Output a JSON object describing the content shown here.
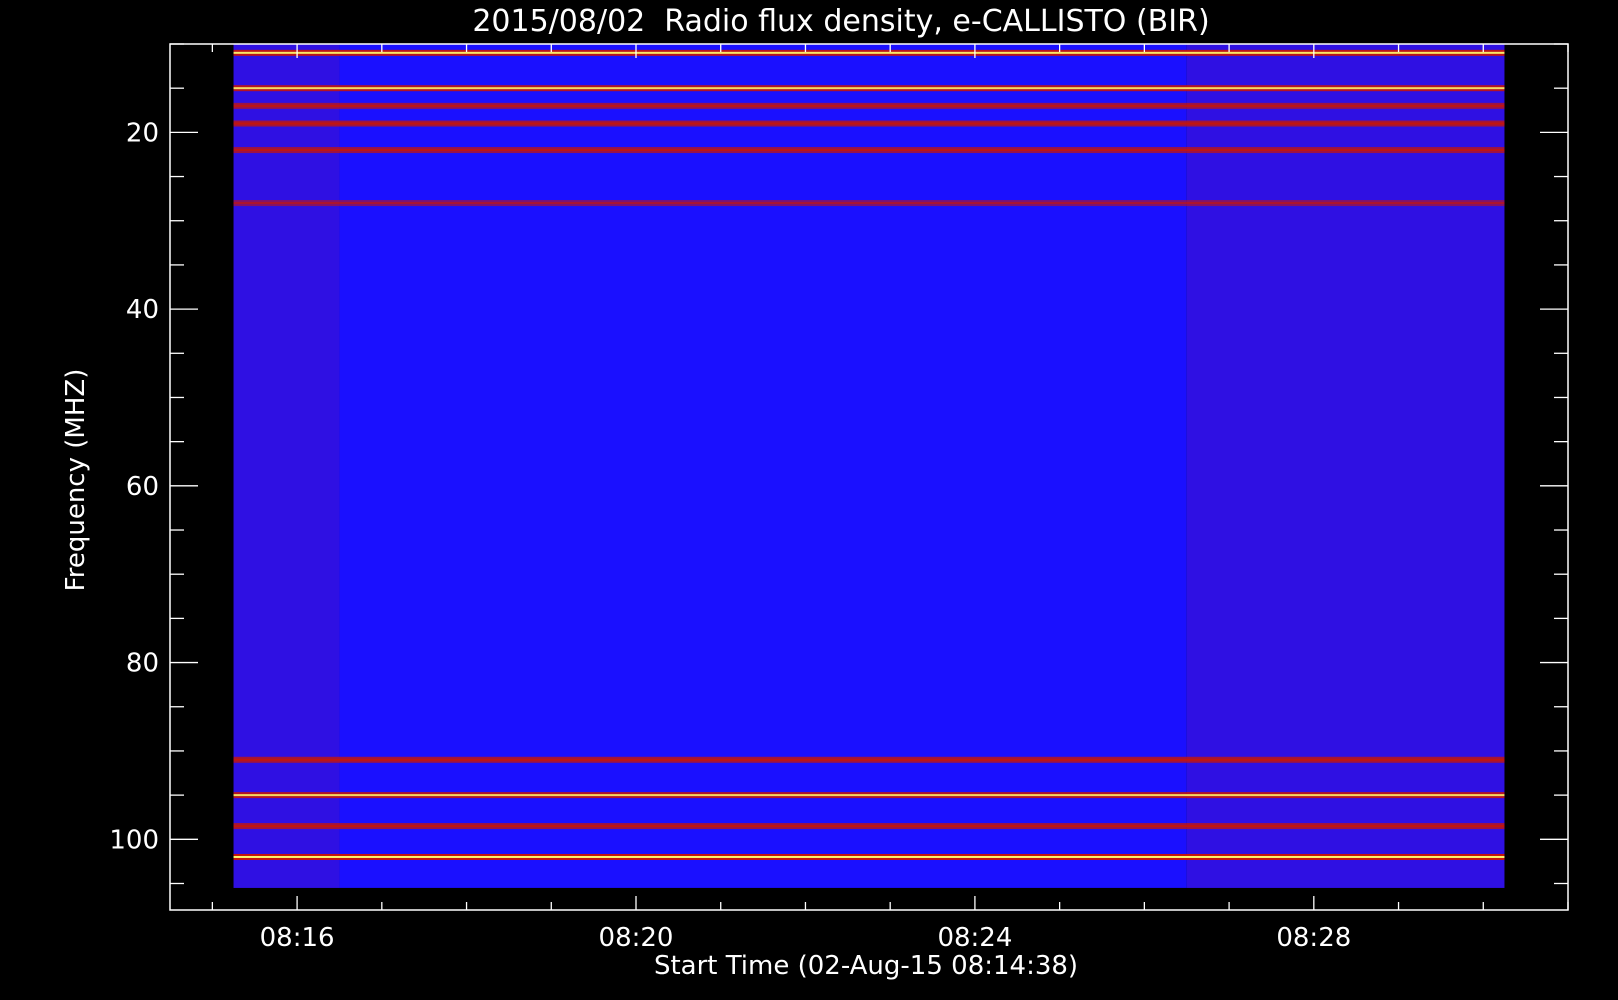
{
  "chart_data": {
    "type": "heatmap",
    "title": "2015/08/02  Radio flux density, e-CALLISTO (BIR)",
    "xlabel": "Start Time (02-Aug-15 08:14:38)",
    "ylabel": "Frequency (MHZ)",
    "x_ticks": [
      "08:16",
      "08:20",
      "08:24",
      "08:28"
    ],
    "x_tick_minutes": [
      16,
      20,
      24,
      28
    ],
    "y_ticks": [
      20,
      40,
      60,
      80,
      100
    ],
    "xlim_minutes": [
      14.5,
      31
    ],
    "ylim_mhz": [
      10,
      108
    ],
    "data_extent": {
      "time_start_minutes": 15.25,
      "time_end_minutes": 30.25,
      "freq_min_mhz": 10,
      "freq_max_mhz": 105.5
    },
    "segments": [
      {
        "label": "high background",
        "time_start_minutes": 15.25,
        "time_end_minutes": 16.5
      },
      {
        "label": "low background",
        "time_start_minutes": 16.5,
        "time_end_minutes": 26.5
      },
      {
        "label": "high background",
        "time_start_minutes": 26.5,
        "time_end_minutes": 30.25
      }
    ],
    "bright_bands_mhz": [
      {
        "freq": 11,
        "intensity": 0.9
      },
      {
        "freq": 15,
        "intensity": 0.85
      },
      {
        "freq": 17,
        "intensity": 0.7
      },
      {
        "freq": 19,
        "intensity": 0.75
      },
      {
        "freq": 22,
        "intensity": 0.7
      },
      {
        "freq": 28,
        "intensity": 0.55
      },
      {
        "freq": 91,
        "intensity": 0.75
      },
      {
        "freq": 95,
        "intensity": 0.85
      },
      {
        "freq": 98.5,
        "intensity": 0.75
      },
      {
        "freq": 102,
        "intensity": 0.95
      }
    ],
    "colors": {
      "background": "#000000",
      "axes": "#ffffff",
      "low": "#1a10ff",
      "mid": "#cc1500",
      "high": "#ffff70"
    }
  }
}
